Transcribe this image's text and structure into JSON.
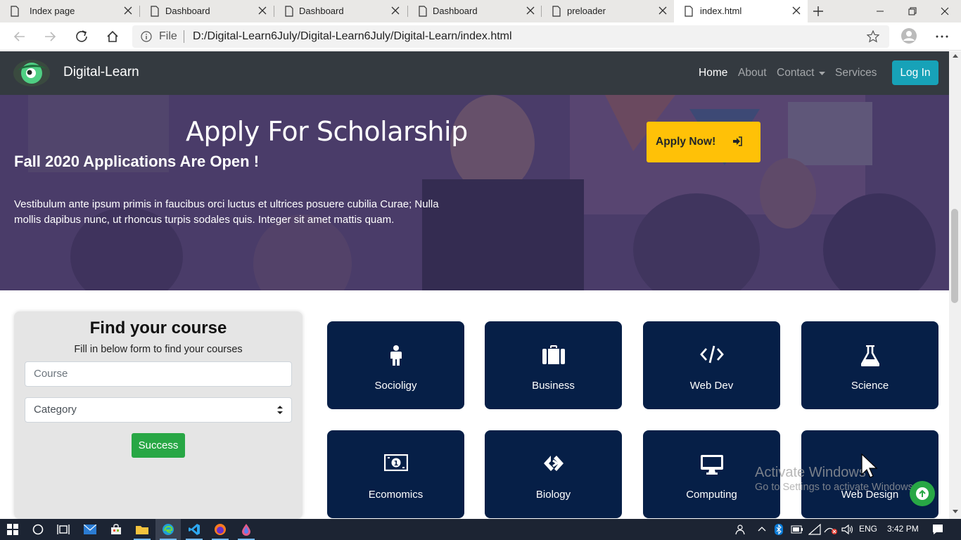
{
  "browser": {
    "tabs": [
      {
        "title": "Index page",
        "active": false
      },
      {
        "title": "Dashboard",
        "active": false
      },
      {
        "title": "Dashboard",
        "active": false
      },
      {
        "title": "Dashboard",
        "active": false
      },
      {
        "title": "preloader",
        "active": false
      },
      {
        "title": "index.html",
        "active": true
      }
    ],
    "address": {
      "scheme_label": "File",
      "url": "D:/Digital-Learn6July/Digital-Learn6July/Digital-Learn/index.html"
    }
  },
  "site": {
    "brand": "Digital-Learn",
    "nav": {
      "home": "Home",
      "about": "About",
      "contact": "Contact",
      "services": "Services",
      "login": "Log In"
    },
    "hero": {
      "title": "Apply For Scholarship",
      "subtitle": "Fall 2020 Applications Are Open !",
      "text": "Vestibulum ante ipsum primis in faucibus orci luctus et ultrices posuere cubilia Curae; Nulla mollis dapibus nunc, ut rhoncus turpis sodales quis. Integer sit amet mattis quam.",
      "apply_label": "Apply Now!"
    },
    "find_course": {
      "title": "Find your course",
      "description": "Fill in below form to find your courses",
      "course_placeholder": "Course",
      "category_selected": "Category",
      "submit_label": "Success"
    },
    "courses": [
      {
        "label": "Socioligy",
        "icon": "person-icon"
      },
      {
        "label": "Business",
        "icon": "briefcase-icon"
      },
      {
        "label": "Web Dev",
        "icon": "code-icon"
      },
      {
        "label": "Science",
        "icon": "flask-icon"
      },
      {
        "label": "Ecomomics",
        "icon": "money-bill-icon"
      },
      {
        "label": "Biology",
        "icon": "linked-diamonds-icon"
      },
      {
        "label": "Computing",
        "icon": "desktop-icon"
      },
      {
        "label": "Web Design",
        "icon": "paint-icon"
      }
    ]
  },
  "watermark": {
    "line1": "Activate Windows",
    "line2": "Go to Settings to activate Windows."
  },
  "taskbar": {
    "language": "ENG",
    "time": "3:42 PM"
  },
  "colors": {
    "navbar": "#343a40",
    "login": "#17a2b8",
    "apply": "#ffc107",
    "success": "#28a745",
    "tile": "#061f47",
    "hero_overlay": "#3c2e64"
  }
}
